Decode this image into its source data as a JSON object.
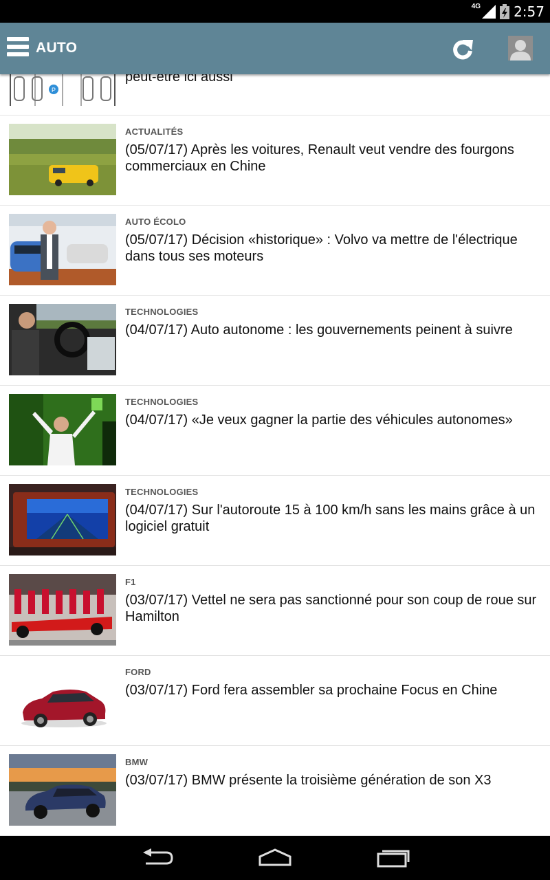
{
  "status_bar": {
    "time": "2:57",
    "network": "4G"
  },
  "app_bar": {
    "title": "AUTO"
  },
  "articles": [
    {
      "category": "",
      "headline": "peut-être ici aussi"
    },
    {
      "category": "ACTUALITÉS",
      "headline": "(05/07/17) Après les voitures, Renault veut vendre des fourgons commerciaux en Chine"
    },
    {
      "category": "AUTO ÉCOLO",
      "headline": "(05/07/17) Décision «historique» : Volvo va mettre de l'électrique dans tous ses moteurs"
    },
    {
      "category": "TECHNOLOGIES",
      "headline": "(04/07/17) Auto autonome : les gouvernements peinent à suivre"
    },
    {
      "category": "TECHNOLOGIES",
      "headline": "(04/07/17) «Je veux gagner la partie des véhicules autonomes»"
    },
    {
      "category": "TECHNOLOGIES",
      "headline": "(04/07/17) Sur l'autoroute 15 à 100 km/h sans les mains grâce à un logiciel gratuit"
    },
    {
      "category": "F1",
      "headline": "(03/07/17) Vettel ne sera pas sanctionné pour son coup de roue sur Hamilton"
    },
    {
      "category": "FORD",
      "headline": "(03/07/17) Ford fera assembler sa prochaine Focus en Chine"
    },
    {
      "category": "BMW",
      "headline": "(03/07/17) BMW présente la troisième génération de son X3"
    }
  ],
  "icons": {
    "menu": "hamburger-icon",
    "refresh": "refresh-icon",
    "profile": "avatar-icon",
    "back": "back-icon",
    "home": "home-icon",
    "recents": "recents-icon"
  },
  "colors": {
    "app_bar": "#5f8596",
    "category_text": "#555555",
    "headline_text": "#111111"
  }
}
